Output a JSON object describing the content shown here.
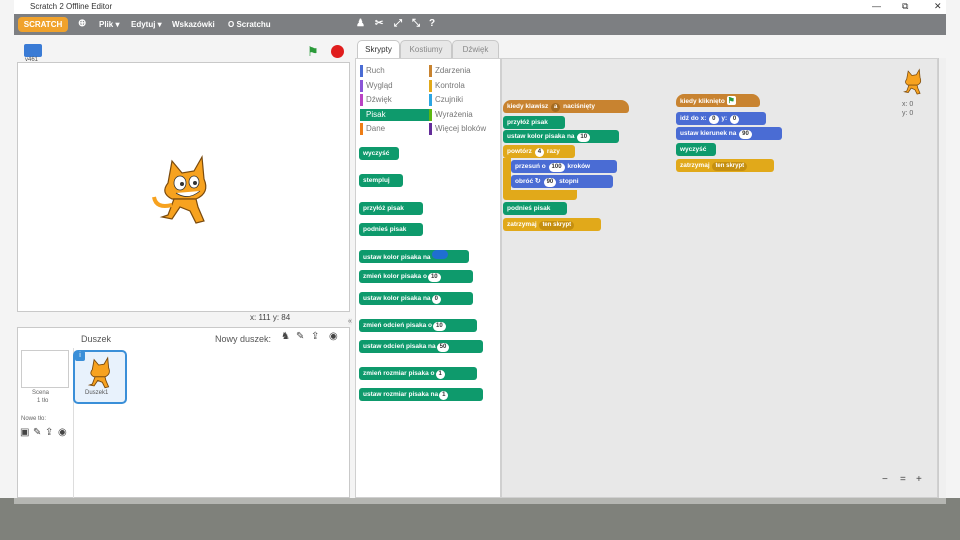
{
  "window": {
    "title": "Scratch 2 Offline Editor",
    "minimize": "—",
    "maximize": "⧉",
    "close": "✕"
  },
  "menubar": {
    "logo": "SCRATCH",
    "items": [
      "Plik ▾",
      "Edytuj ▾",
      "Wskazówki",
      "O Scratchu"
    ]
  },
  "stage": {
    "version_label": "v461",
    "coords": "x: 111  y: 84"
  },
  "sprites": {
    "title": "Duszek",
    "new_sprite_label": "Nowy duszek:",
    "stage_label": "Scena",
    "stage_sub": "1 tło",
    "sprite_name": "Duszek1",
    "new_backdrop_label": "Nowe tło:"
  },
  "tabs": [
    "Skrypty",
    "Kostiumy",
    "Dźwięk"
  ],
  "categories": [
    {
      "label": "Ruch",
      "color": "#4a6cd4"
    },
    {
      "label": "Zdarzenia",
      "color": "#c88330"
    },
    {
      "label": "Wygląd",
      "color": "#8a55d7"
    },
    {
      "label": "Kontrola",
      "color": "#e1a91a"
    },
    {
      "label": "Dźwięk",
      "color": "#bb42c3"
    },
    {
      "label": "Czujniki",
      "color": "#2ca5e2"
    },
    {
      "label": "Pisak",
      "color": "#0e9a6c"
    },
    {
      "label": "Wyrażenia",
      "color": "#5cb712"
    },
    {
      "label": "Dane",
      "color": "#ee7d16"
    },
    {
      "label": "Więcej bloków",
      "color": "#632d99"
    }
  ],
  "palette_blocks": [
    "wyczyść",
    "stempluj",
    "przyłóż pisak",
    "podnieś pisak",
    "ustaw kolor pisaka na",
    "zmień kolor pisaka o",
    "ustaw kolor pisaka na",
    "zmień odcień pisaka o",
    "ustaw odcień pisaka na",
    "zmień rozmiar pisaka o",
    "ustaw rozmiar pisaka na"
  ],
  "palette_values": [
    "",
    "10",
    "0",
    "10",
    "50",
    "1",
    "1"
  ],
  "script1": {
    "hat": "kiedy klawisz",
    "hat_key": "a",
    "hat_tail": "naciśnięty",
    "b1": "przyłóż pisak",
    "b2": "ustaw kolor pisaka na",
    "b2_val": "10",
    "rep": "powtórz",
    "rep_val": "4",
    "rep_tail": "razy",
    "move": "przesuń o",
    "move_val": "100",
    "move_tail": "kroków",
    "turn": "obróć",
    "turn_val": "90",
    "turn_tail": "stopni",
    "b3": "podnieś pisak",
    "stop": "zatrzymaj",
    "stop_val": "ten skrypt"
  },
  "script2": {
    "hat": "kiedy kliknięto",
    "go": "idź do x:",
    "go_x": "0",
    "go_y_label": "y:",
    "go_y": "0",
    "dir": "ustaw kierunek na",
    "dir_val": "90",
    "clear": "wyczyść",
    "stop": "zatrzymaj",
    "stop_val": "ten skrypt"
  },
  "sprite_info": {
    "x": "x: 0",
    "y": "y: 0"
  },
  "zoom": {
    "out": "−",
    "reset": "=",
    "in": "+"
  }
}
